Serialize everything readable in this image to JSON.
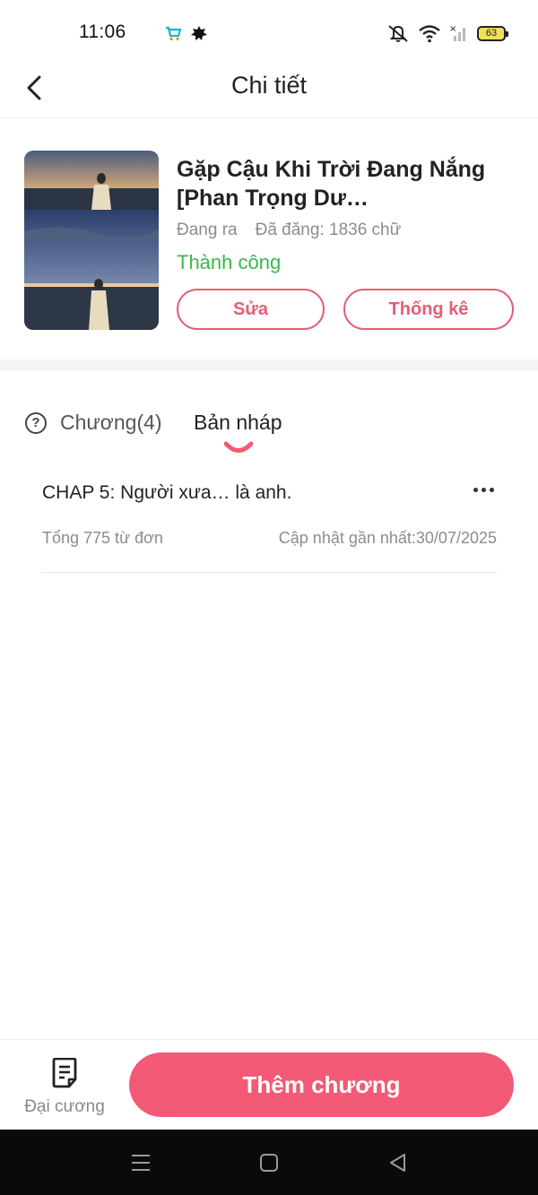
{
  "status_bar": {
    "time": "11:06",
    "battery": "63"
  },
  "header": {
    "title": "Chi tiết"
  },
  "book": {
    "title": "Gặp Cậu Khi Trời Đang Nắng [Phan Trọng Dư…",
    "state": "Đang ra",
    "published": "Đã đăng: 1836 chữ",
    "status": "Thành công",
    "status_color": "#3cb84a",
    "edit_label": "Sửa",
    "stats_label": "Thống kê"
  },
  "tabs": {
    "chapters": "Chương(4)",
    "drafts": "Bản nháp"
  },
  "drafts": [
    {
      "title": "CHAP 5: Người xưa… là anh.",
      "words": "Tổng 775 từ đơn",
      "updated": "Cập nhật gần nhất:30/07/2025"
    }
  ],
  "bottom": {
    "outline_label": "Đại cương",
    "add_chapter_label": "Thêm chương",
    "accent": "#f25a76"
  }
}
